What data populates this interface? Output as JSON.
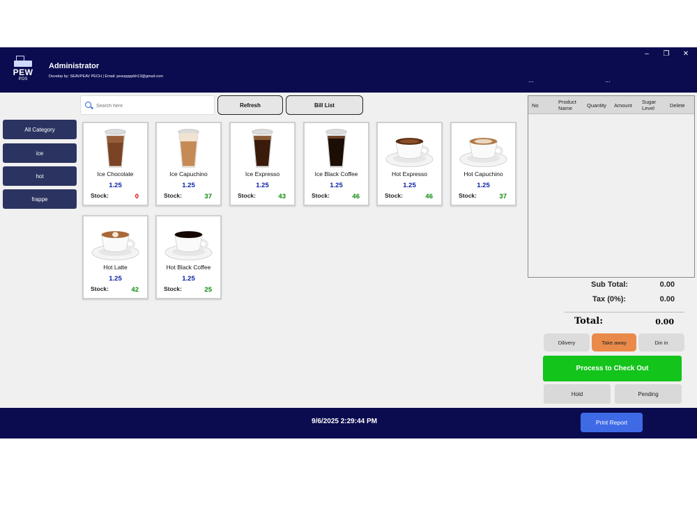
{
  "header": {
    "logo_text": "PEW",
    "logo_sub": "POS",
    "title": "Administrator",
    "credit": "Develop by: SEAVPEAV PECH | Email: peavppppkh13@gmail.com",
    "dots_left": "...",
    "dots_right": "...",
    "window_controls": {
      "minimize": "–",
      "restore": "❐",
      "close": "✕"
    },
    "colors": {
      "background": "#0b0b4f",
      "text": "#ffffff"
    }
  },
  "search": {
    "placeholder": "Search here",
    "value": ""
  },
  "toolbar": {
    "refresh_label": "Refresh",
    "bill_list_label": "Bill List"
  },
  "categories": [
    {
      "label": "All Category"
    },
    {
      "label": "ice"
    },
    {
      "label": "hot"
    },
    {
      "label": "frappe"
    }
  ],
  "products": [
    {
      "name": "Ice Chocolate",
      "price": "1.25",
      "stock_label": "Stock:",
      "stock": "0",
      "stock_color": "#e00000",
      "image": "iced-chocolate-cup-icon"
    },
    {
      "name": "Ice Capuchino",
      "price": "1.25",
      "stock_label": "Stock:",
      "stock": "37",
      "stock_color": "#0b8a0b",
      "image": "iced-cappuccino-cup-icon"
    },
    {
      "name": "Ice Expresso",
      "price": "1.25",
      "stock_label": "Stock:",
      "stock": "43",
      "stock_color": "#0b8a0b",
      "image": "iced-espresso-cup-icon"
    },
    {
      "name": "Ice Black Coffee",
      "price": "1.25",
      "stock_label": "Stock:",
      "stock": "46",
      "stock_color": "#0b8a0b",
      "image": "iced-black-coffee-cup-icon"
    },
    {
      "name": "Hot Expresso",
      "price": "1.25",
      "stock_label": "Stock:",
      "stock": "46",
      "stock_color": "#0b8a0b",
      "image": "hot-espresso-cup-icon"
    },
    {
      "name": "Hot Capuchino",
      "price": "1.25",
      "stock_label": "Stock:",
      "stock": "37",
      "stock_color": "#0b8a0b",
      "image": "hot-cappuccino-cup-icon"
    },
    {
      "name": "Hot Latte",
      "price": "1.25",
      "stock_label": "Stock:",
      "stock": "42",
      "stock_color": "#0b8a0b",
      "image": "hot-latte-cup-icon"
    },
    {
      "name": "Hot Black Coffee",
      "price": "1.25",
      "stock_label": "Stock:",
      "stock": "25",
      "stock_color": "#0b8a0b",
      "image": "hot-black-coffee-cup-icon"
    }
  ],
  "bill": {
    "columns": [
      {
        "label": "No"
      },
      {
        "label": "Product Name"
      },
      {
        "label": "Quantity"
      },
      {
        "label": "Amount"
      },
      {
        "label": "Sugar Level"
      },
      {
        "label": "Delete"
      }
    ],
    "rows": []
  },
  "totals": {
    "subtotal_label": "Sub Total:",
    "subtotal": "0.00",
    "tax_label": "Tax (0%):",
    "tax": "0.00",
    "total_label": "Total:",
    "total": "0.00"
  },
  "order_type": {
    "delivery_label": "Dilivery",
    "takeaway_label": "Take away",
    "dinein_label": "Din in",
    "selected": "Take away",
    "selected_color": "#ea8a4a"
  },
  "actions": {
    "checkout_label": "Process to Check Out",
    "checkout_color": "#13c41b",
    "hold_label": "Hold",
    "pending_label": "Pending"
  },
  "footer": {
    "datetime": "9/6/2025 2:29:44 PM",
    "print_label": "Print Report",
    "print_color": "#3f6ae6"
  }
}
